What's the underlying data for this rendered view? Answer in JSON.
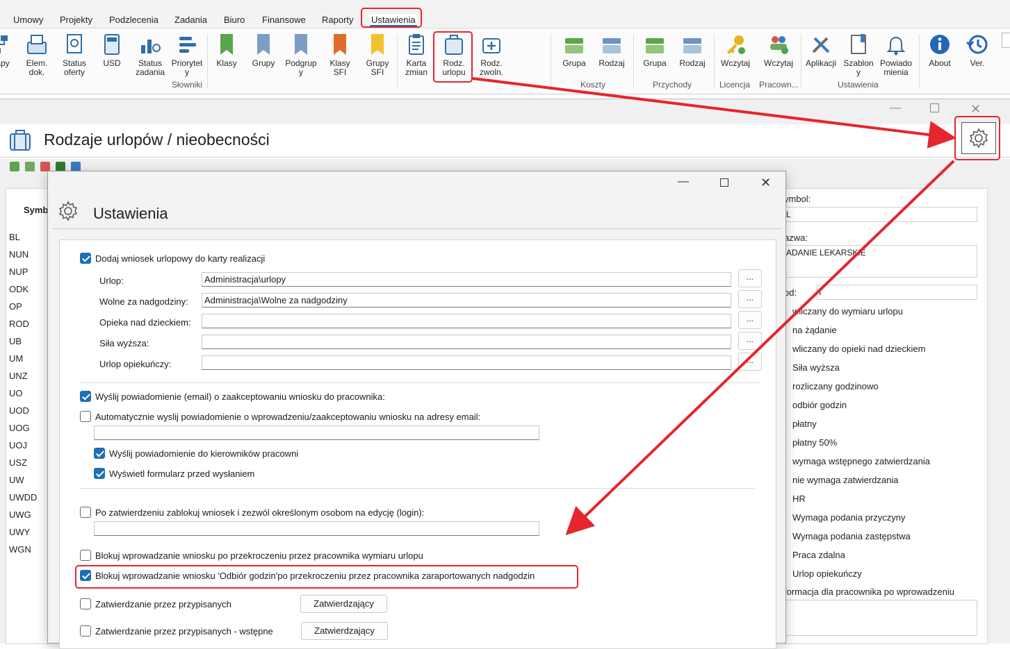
{
  "menu": {
    "tabs": [
      "Umowy",
      "Projekty",
      "Podzlecenia",
      "Zadania",
      "Biuro",
      "Finansowe",
      "Raporty",
      "Ustawienia"
    ]
  },
  "ribbon": {
    "buttons": [
      {
        "label": "apy",
        "icon": "org-icon"
      },
      {
        "label": "Elem.\ndok.",
        "icon": "document-tray-icon"
      },
      {
        "label": "Status\noferty",
        "icon": "certificate-icon"
      },
      {
        "label": "USD",
        "icon": "calculator-icon"
      },
      {
        "label": "Status\nzadania",
        "icon": "workflow-icon"
      },
      {
        "label": "Priorytet\ny",
        "icon": "priority-icon"
      },
      {
        "label": "Klasy",
        "icon": "bookmark-green-icon"
      },
      {
        "label": "Grupy",
        "icon": "bookmark-blue-icon"
      },
      {
        "label": "Podgrup\ny",
        "icon": "bookmark-blue-icon"
      },
      {
        "label": "Klasy\nSFI",
        "icon": "bookmark-orange-icon"
      },
      {
        "label": "Grupy\nSFI",
        "icon": "bookmark-yellow-icon"
      },
      {
        "label": "Karta\nzmian",
        "icon": "clipboard-icon"
      },
      {
        "label": "Rodz.\nurlopu",
        "icon": "suitcase-icon"
      },
      {
        "label": "Rodz.\nzwoln.",
        "icon": "medical-case-icon"
      },
      {
        "label": "Grupa",
        "icon": "stack-green-icon"
      },
      {
        "label": "Rodzaj",
        "icon": "stack-blue-icon"
      },
      {
        "label": "Grupa",
        "icon": "stack-green-icon"
      },
      {
        "label": "Rodzaj",
        "icon": "stack-blue-icon"
      },
      {
        "label": "Wczytaj",
        "icon": "key-icon"
      },
      {
        "label": "Wczytaj",
        "icon": "users-add-icon"
      },
      {
        "label": "Aplikacji",
        "icon": "tools-icon"
      },
      {
        "label": "Szablon\ny",
        "icon": "template-icon"
      },
      {
        "label": "Powiado\nmienia",
        "icon": "bell-icon"
      },
      {
        "label": "About",
        "icon": "info-icon"
      },
      {
        "label": "Ver.",
        "icon": "history-icon"
      }
    ],
    "groups": [
      "Słowniki",
      "Koszty",
      "Przychody",
      "Licencja",
      "Pracown...",
      "Ustawienia"
    ]
  },
  "main_window": {
    "title": "Rodzaje urlopów / nieobecności",
    "list_header": "Symb",
    "symbols": [
      "BL",
      "NUN",
      "NUP",
      "ODK",
      "OP",
      "ROD",
      "UB",
      "UM",
      "UNZ",
      "UO",
      "UOD",
      "UOG",
      "UOJ",
      "USZ",
      "UW",
      "UWDD",
      "UWG",
      "UWY",
      "WGN"
    ],
    "detail": {
      "symbol_label": "ymbol:",
      "symbol_value": "L",
      "name_label": "azwa:",
      "name_value": "ADANIE LEKARSKIE",
      "code_label": "od:",
      "code_value": "I",
      "checks": [
        "wliczany do wymiaru urlopu",
        "na żądanie",
        "wliczany do opieki nad dzieckiem",
        "Siła wyższa",
        "rozliczany godzinowo",
        "odbiór godzin",
        "płatny",
        "płatny 50%",
        "wymaga wstępnego zatwierdzania",
        "nie wymaga zatwierdzania",
        "HR",
        "Wymaga podania przyczyny",
        "Wymaga podania zastępstwa",
        "Praca zdalna",
        "Urlop opiekuńczy"
      ],
      "info_label": "formacja dla pracownika po wprowadzeniu"
    }
  },
  "dialog": {
    "title": "Ustawienia",
    "add_request": "Dodaj wniosek urlopowy do karty realizacji",
    "fields": [
      {
        "label": "Urlop:",
        "value": "Administracja\\urlopy"
      },
      {
        "label": "Wolne za nadgodziny:",
        "value": "Administracja\\Wolne za nadgodziny"
      },
      {
        "label": "Opieka nad dzieckiem:",
        "value": ""
      },
      {
        "label": "Siła wyższa:",
        "value": ""
      },
      {
        "label": "Urlop opiekuńczy:",
        "value": ""
      }
    ],
    "browse_label": "...",
    "send_email": "Wyślij powiadomienie (email) o zaakceptowaniu wniosku do pracownika:",
    "auto_send": "Automatycznie wyslij powiadomienie o wprowadzeniu/zaakceptowaniu wniosku na adresy email:",
    "notify_managers": "Wyślij powiadomienie do kierowników pracowni",
    "show_form": "Wyświetl formularz przed wysłaniem",
    "lock_after": "Po zatwierdzeniu zablokuj wniosek i zezwól określonym osobom na edycję (login):",
    "block_limit": "Blokuj wprowadzanie wniosku po przekroczeniu przez pracownika wymiaru urlopu",
    "block_overtime": "Blokuj wprowadzanie wniosku 'Odbiór godzin'po przekroczeniu przez pracownika zaraportowanych nadgodzin",
    "approve_assigned": "Zatwierdzanie przez przypisanych",
    "approve_assigned_pre": "Zatwierdzanie przez przypisanych - wstępne",
    "approver_button": "Zatwierdzający"
  },
  "colors": {
    "accent": "#1f6fb2",
    "highlight": "#e5262c"
  }
}
